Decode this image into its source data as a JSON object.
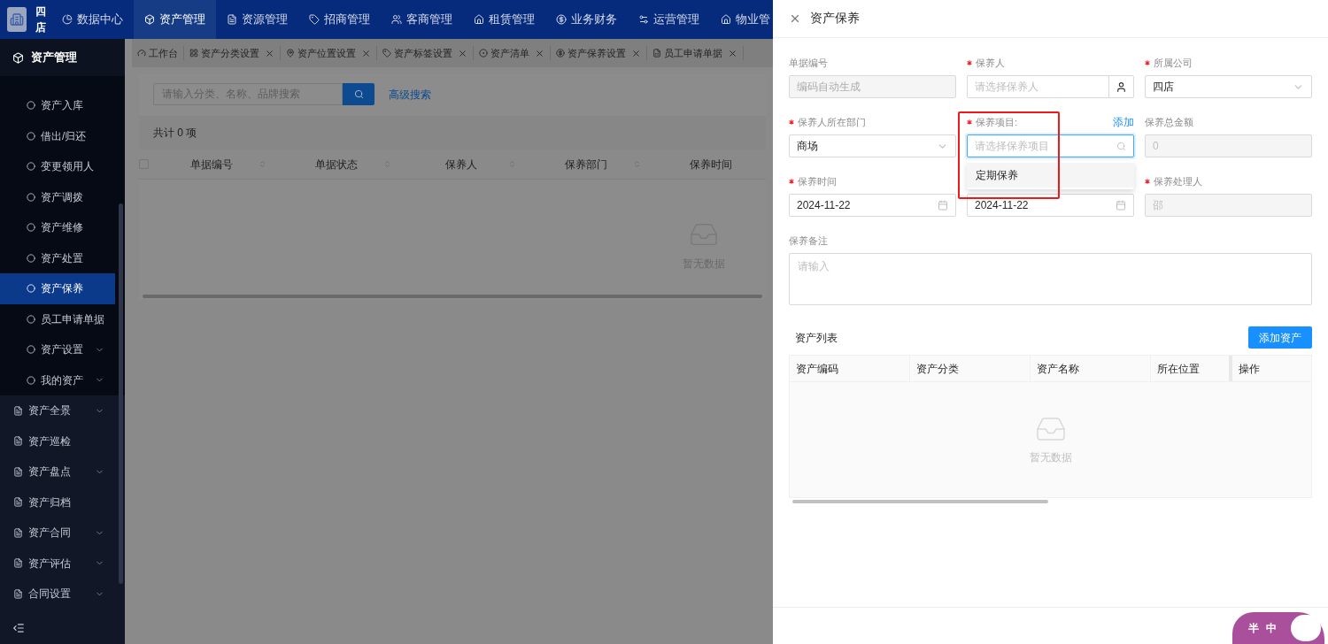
{
  "nav": {
    "brand": "四店",
    "items": [
      {
        "label": "数据中心",
        "selected": false
      },
      {
        "label": "资产管理",
        "selected": true
      },
      {
        "label": "资源管理",
        "selected": false
      },
      {
        "label": "招商管理",
        "selected": false
      },
      {
        "label": "客商管理",
        "selected": false
      },
      {
        "label": "租赁管理",
        "selected": false
      },
      {
        "label": "业务财务",
        "selected": false
      },
      {
        "label": "运营管理",
        "selected": false
      },
      {
        "label": "物业管",
        "selected": false
      }
    ]
  },
  "sidebar": {
    "header": "资产管理",
    "items": [
      {
        "label": "资产入库",
        "kind": "link",
        "selected": false
      },
      {
        "label": "借出/归还",
        "kind": "link",
        "selected": false
      },
      {
        "label": "变更领用人",
        "kind": "link",
        "selected": false
      },
      {
        "label": "资产调拨",
        "kind": "link",
        "selected": false
      },
      {
        "label": "资产维修",
        "kind": "link",
        "selected": false
      },
      {
        "label": "资产处置",
        "kind": "link",
        "selected": false
      },
      {
        "label": "资产保养",
        "kind": "link",
        "selected": true
      },
      {
        "label": "员工申请单据",
        "kind": "link",
        "selected": false
      },
      {
        "label": "资产设置",
        "kind": "group",
        "selected": false
      },
      {
        "label": "我的资产",
        "kind": "group",
        "selected": false
      }
    ],
    "top_items": [
      {
        "label": "资产全景",
        "kind": "group"
      },
      {
        "label": "资产巡检",
        "kind": "link"
      },
      {
        "label": "资产盘点",
        "kind": "group"
      },
      {
        "label": "资产归档",
        "kind": "link"
      },
      {
        "label": "资产合同",
        "kind": "group"
      },
      {
        "label": "资产评估",
        "kind": "group"
      },
      {
        "label": "合同设置",
        "kind": "group"
      }
    ]
  },
  "tabs": [
    {
      "label": "工作台",
      "closable": false
    },
    {
      "label": "资产分类设置",
      "closable": true
    },
    {
      "label": "资产位置设置",
      "closable": true
    },
    {
      "label": "资产标签设置",
      "closable": true
    },
    {
      "label": "资产清单",
      "closable": true
    },
    {
      "label": "资产保养设置",
      "closable": true
    },
    {
      "label": "员工申请单据",
      "closable": true
    }
  ],
  "list": {
    "search_placeholder": "请输入分类、名称、品牌搜索",
    "advanced": "高级搜索",
    "total": "共计 0 项",
    "select_all_checked": false,
    "columns": [
      "单据编号",
      "单据状态",
      "保养人",
      "保养部门",
      "保养时间"
    ],
    "empty": "暂无数据"
  },
  "drawer": {
    "title": "资产保养",
    "fields": [
      {
        "label": "单据编号",
        "kind": "text",
        "required": false,
        "disabled": true,
        "placeholder": "编码自动生成"
      },
      {
        "label": "保养人",
        "kind": "picker",
        "required": true,
        "disabled": false,
        "placeholder": "请选择保养人"
      },
      {
        "label": "所属公司",
        "kind": "select",
        "required": true,
        "disabled": false,
        "value": "四店"
      },
      {
        "label": "保养人所在部门",
        "kind": "select",
        "required": true,
        "disabled": false,
        "value": "商场"
      },
      {
        "label": "保养项目:",
        "kind": "search",
        "required": true,
        "disabled": false,
        "placeholder": "请选择保养项目",
        "link": "添加",
        "options": [
          "定期保养"
        ],
        "annotated": true
      },
      {
        "label": "保养总金额",
        "kind": "text",
        "required": false,
        "disabled": true,
        "value": "0"
      },
      {
        "label": "保养时间",
        "kind": "date",
        "required": true,
        "disabled": false,
        "value": "2024-11-22"
      },
      {
        "kind": "date",
        "disabled": false,
        "value": "2024-11-22"
      },
      {
        "label": "保养处理人",
        "kind": "text",
        "required": true,
        "disabled": true,
        "value": "邵"
      }
    ],
    "remark": {
      "label": "保养备注",
      "placeholder": "请输入"
    },
    "assets": {
      "title": "资产列表",
      "add_button": "添加资产",
      "columns": [
        "资产编码",
        "资产分类",
        "资产名称",
        "所在位置",
        "操作"
      ],
      "empty": "暂无数据"
    }
  },
  "ime": {
    "labels": [
      "半",
      "中"
    ]
  }
}
